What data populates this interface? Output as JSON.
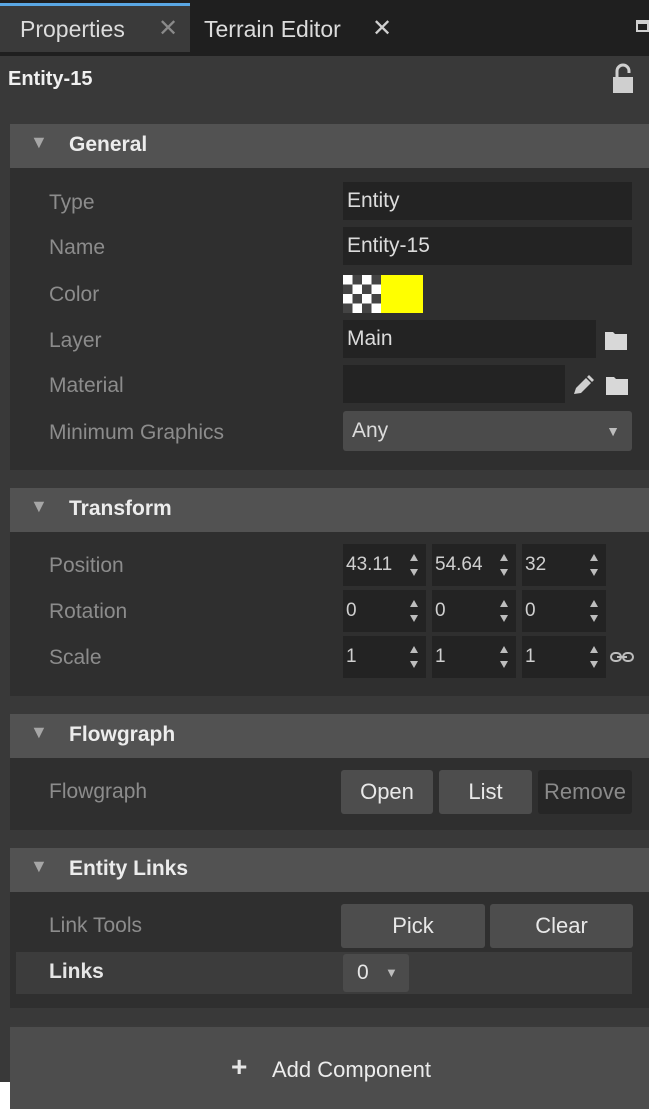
{
  "tabs": [
    {
      "label": "Properties",
      "active": true
    },
    {
      "label": "Terrain Editor",
      "active": false
    }
  ],
  "entity": {
    "name": "Entity-15"
  },
  "icons": {
    "close": "close-icon",
    "maximize": "maximize-icon",
    "lock": "unlock-icon",
    "chevron": "chevron-down-icon",
    "folder": "folder-icon",
    "edit": "pencil-icon",
    "link": "chain-link-icon",
    "plus": "plus-icon",
    "dropdown": "caret-down-icon",
    "spinner": "spinner-arrows-icon"
  },
  "sections": {
    "general": {
      "title": "General",
      "type_label": "Type",
      "type_value": "Entity",
      "name_label": "Name",
      "name_value": "Entity-15",
      "color_label": "Color",
      "color_value": "#ffff00",
      "layer_label": "Layer",
      "layer_value": "Main",
      "material_label": "Material",
      "material_value": "",
      "mingfx_label": "Minimum Graphics",
      "mingfx_value": "Any"
    },
    "transform": {
      "title": "Transform",
      "position_label": "Position",
      "position": [
        "43.11",
        "54.64",
        "32"
      ],
      "rotation_label": "Rotation",
      "rotation": [
        "0",
        "0",
        "0"
      ],
      "scale_label": "Scale",
      "scale": [
        "1",
        "1",
        "1"
      ]
    },
    "flowgraph": {
      "title": "Flowgraph",
      "label": "Flowgraph",
      "open": "Open",
      "list": "List",
      "remove": "Remove"
    },
    "entity_links": {
      "title": "Entity Links",
      "tools_label": "Link Tools",
      "pick": "Pick",
      "clear": "Clear",
      "links_label": "Links",
      "links_value": "0"
    }
  },
  "add_component": {
    "label": "Add Component"
  },
  "colors": {
    "accent": "#5aa7e4",
    "panel": "#393939",
    "header": "#525252"
  }
}
